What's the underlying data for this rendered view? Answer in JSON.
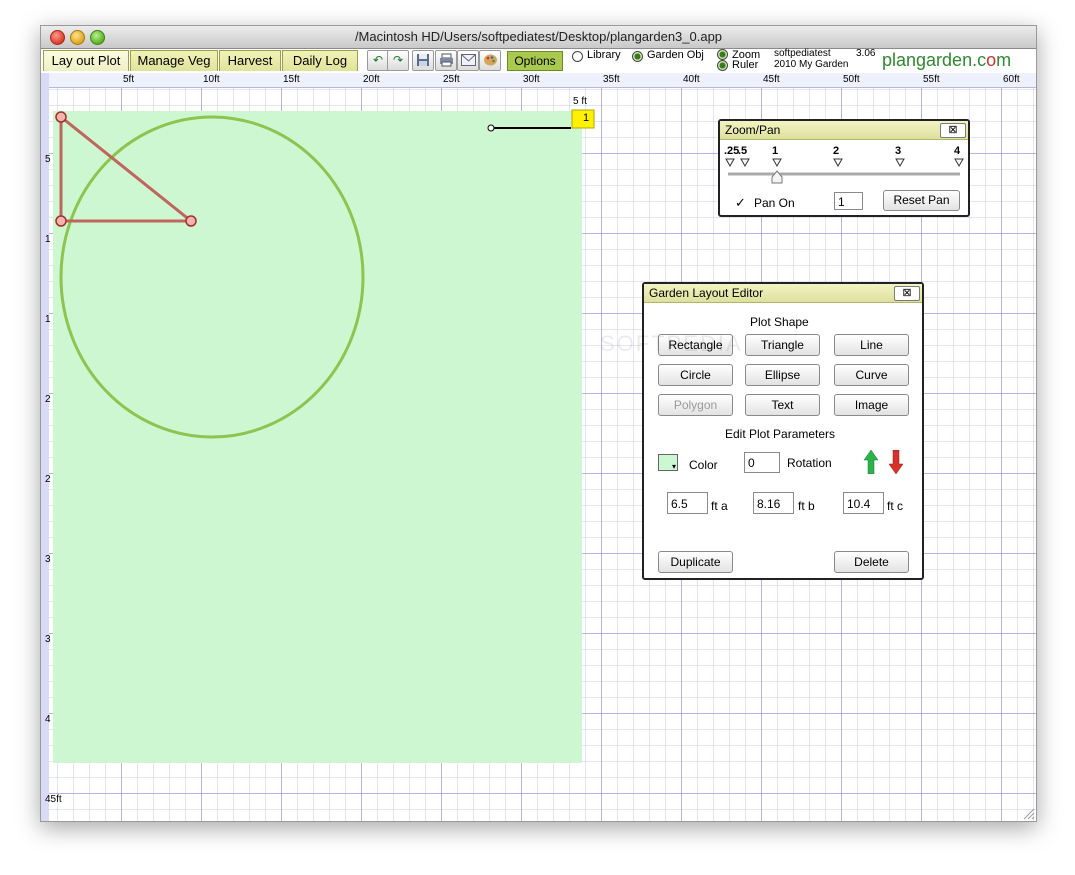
{
  "window": {
    "title": "/Macintosh HD/Users/softpediatest/Desktop/plangarden3_0.app"
  },
  "tabs": [
    {
      "label": "Lay out Plot"
    },
    {
      "label": "Manage Veg"
    },
    {
      "label": "Harvest"
    },
    {
      "label": "Daily Log"
    }
  ],
  "toolbar": {
    "options_label": "Options",
    "library_label": "Library",
    "garden_obj_label": "Garden Obj",
    "zoom_label": "Zoom",
    "ruler_label": "Ruler",
    "user": "softpediatest",
    "version": "3.06",
    "garden_name": "2010 My Garden",
    "logo_left": "plangarden.c",
    "logo_o": "o",
    "logo_right": "m"
  },
  "ruler": {
    "top_labels": [
      "5ft",
      "10ft",
      "15ft",
      "20ft",
      "25ft",
      "30ft",
      "35ft",
      "40ft",
      "45ft",
      "50ft",
      "55ft",
      "60ft"
    ],
    "left_labels": [
      "5",
      "1",
      "1",
      "2",
      "2",
      "3",
      "3",
      "4"
    ],
    "bottom_label": "45ft",
    "scale_label": "5 ft",
    "scale_marker": "1"
  },
  "zoom_pan": {
    "title": "Zoom/Pan",
    "close": "⊠",
    "ticks": [
      ".25",
      ".5",
      "1",
      "2",
      "3",
      "4"
    ],
    "pan_on_label": "Pan On",
    "pan_on_checked": "✓",
    "zoom_value": "1",
    "reset_label": "Reset Pan"
  },
  "layout_editor": {
    "title": "Garden Layout Editor",
    "close": "⊠",
    "plot_shape_heading": "Plot Shape",
    "shapes": [
      "Rectangle",
      "Triangle",
      "Line",
      "Circle",
      "Ellipse",
      "Curve",
      "Polygon",
      "Text",
      "Image"
    ],
    "edit_heading": "Edit Plot Parameters",
    "color_label": "Color",
    "color_value": "#ccf7d1",
    "rotation_value": "0",
    "rotation_label": "Rotation",
    "a_value": "6.5",
    "a_label": "ft a",
    "b_value": "8.16",
    "b_label": "ft b",
    "c_value": "10.4",
    "c_label": "ft c",
    "duplicate_label": "Duplicate",
    "delete_label": "Delete"
  },
  "watermark": "SOFTPEDIA"
}
